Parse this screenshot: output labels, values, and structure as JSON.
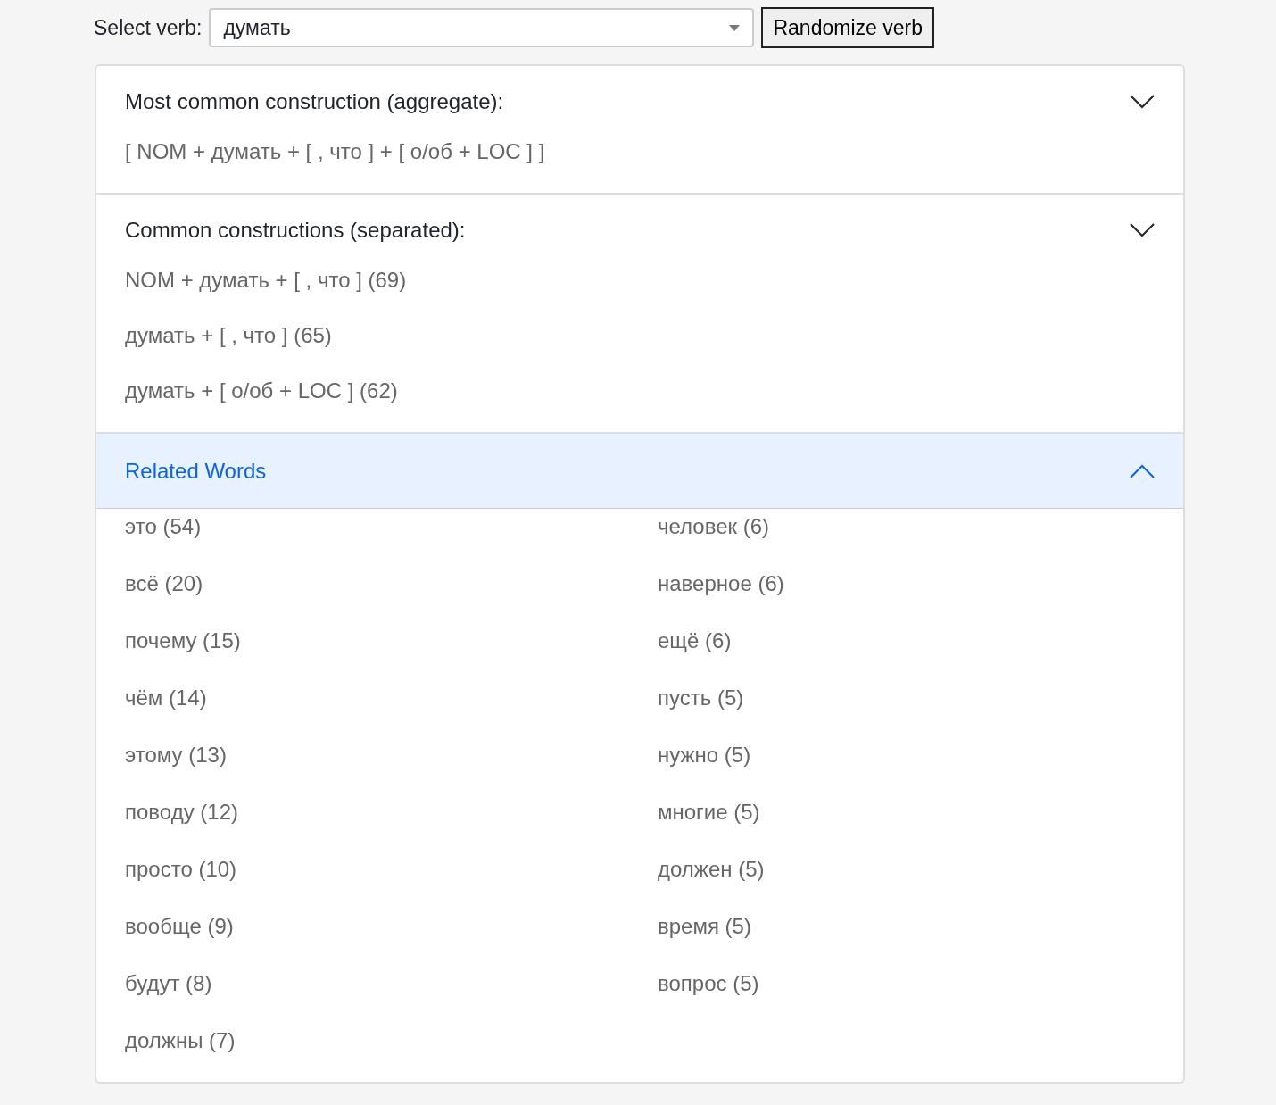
{
  "verb_picker": {
    "label": "Select verb:",
    "value": "думать",
    "button": "Randomize verb"
  },
  "sections": [
    {
      "title": "Most common construction (aggregate):",
      "active": false,
      "lines": [
        "[ NOM + думать + [ , что ] + [ о/об + LOC ] ]"
      ]
    },
    {
      "title": "Common constructions (separated):",
      "active": false,
      "lines": [
        "NOM + думать + [ , что ] (69)",
        "думать + [ , что ] (65)",
        "думать + [ о/об + LOC ] (62)"
      ]
    },
    {
      "title": "Related Words",
      "active": true,
      "words": [
        "это (54)",
        "всё (20)",
        "почему (15)",
        "чём (14)",
        "этому (13)",
        "поводу (12)",
        "просто (10)",
        "вообще (9)",
        "будут (8)",
        "должны (7)",
        "человек (6)",
        "наверное (6)",
        "ещё (6)",
        "пусть (5)",
        "нужно (5)",
        "многие (5)",
        "должен (5)",
        "время (5)",
        "вопрос (5)"
      ]
    }
  ]
}
